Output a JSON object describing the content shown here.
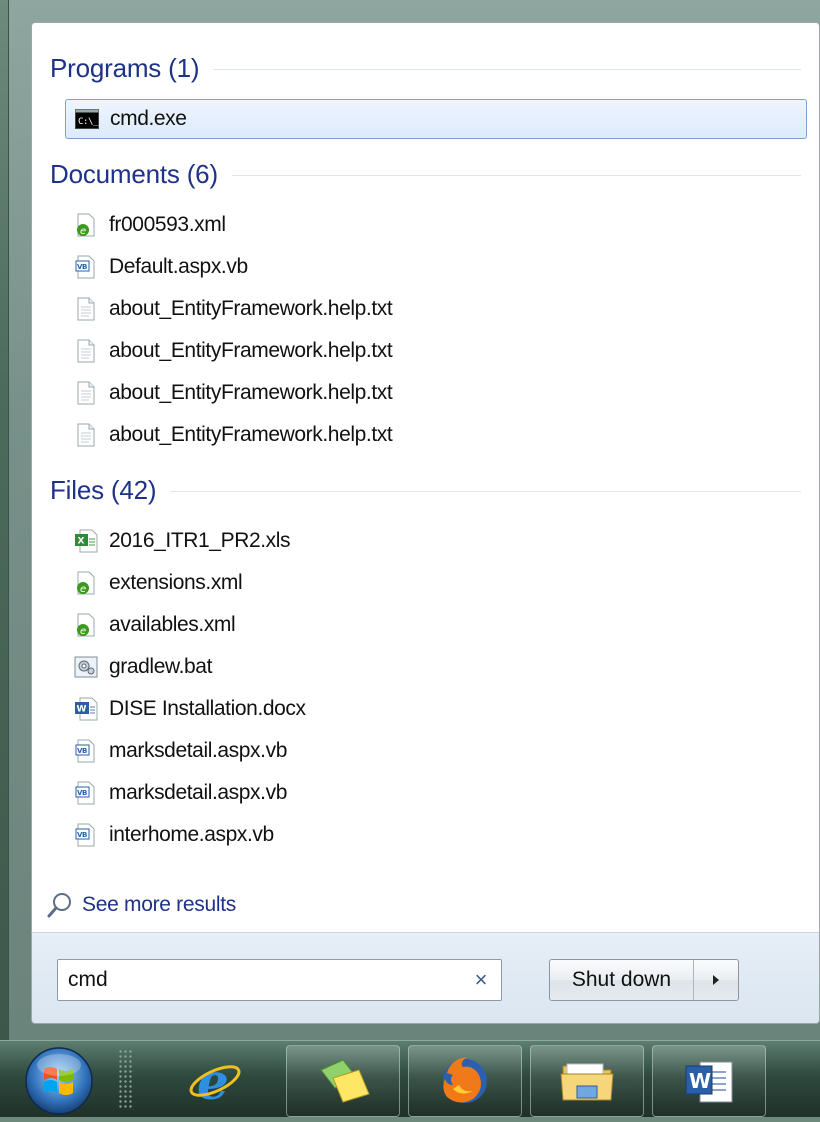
{
  "sections": {
    "programs": {
      "title": "Programs (1)",
      "items": [
        {
          "label": "cmd.exe",
          "icon": "cmd-icon"
        }
      ]
    },
    "documents": {
      "title": "Documents (6)",
      "items": [
        {
          "label": "fr000593.xml",
          "icon": "xml-file-icon"
        },
        {
          "label": "Default.aspx.vb",
          "icon": "vb-file-icon"
        },
        {
          "label": "about_EntityFramework.help.txt",
          "icon": "text-file-icon"
        },
        {
          "label": "about_EntityFramework.help.txt",
          "icon": "text-file-icon"
        },
        {
          "label": "about_EntityFramework.help.txt",
          "icon": "text-file-icon"
        },
        {
          "label": "about_EntityFramework.help.txt",
          "icon": "text-file-icon"
        }
      ]
    },
    "files": {
      "title": "Files (42)",
      "items": [
        {
          "label": "2016_ITR1_PR2.xls",
          "icon": "excel-file-icon"
        },
        {
          "label": "extensions.xml",
          "icon": "xml-file-icon"
        },
        {
          "label": "availables.xml",
          "icon": "xml-file-icon"
        },
        {
          "label": "gradlew.bat",
          "icon": "batch-file-icon"
        },
        {
          "label": "DISE Installation.docx",
          "icon": "word-file-icon"
        },
        {
          "label": "marksdetail.aspx.vb",
          "icon": "vb-file-icon"
        },
        {
          "label": "marksdetail.aspx.vb",
          "icon": "vb-file-icon"
        },
        {
          "label": "interhome.aspx.vb",
          "icon": "vb-file-icon"
        }
      ]
    }
  },
  "see_more": {
    "label": "See more results",
    "icon": "search-icon"
  },
  "search": {
    "value": "cmd",
    "clear_glyph": "×"
  },
  "shutdown": {
    "label": "Shut down",
    "arrow_icon": "chevron-right-icon"
  },
  "taskbar": {
    "buttons": [
      {
        "name": "start-button",
        "icon": "windows-orb-icon"
      },
      {
        "name": "internet-explorer",
        "icon": "internet-explorer-icon"
      },
      {
        "name": "sticky-notes",
        "icon": "sticky-notes-icon"
      },
      {
        "name": "firefox",
        "icon": "firefox-icon"
      },
      {
        "name": "file-explorer",
        "icon": "folder-icon"
      },
      {
        "name": "microsoft-word",
        "icon": "word-icon"
      }
    ]
  },
  "colors": {
    "section_title": "#1e3287",
    "selected_bg": "#dcebfc",
    "selected_border": "#7da2ce",
    "link": "#1e3287"
  }
}
